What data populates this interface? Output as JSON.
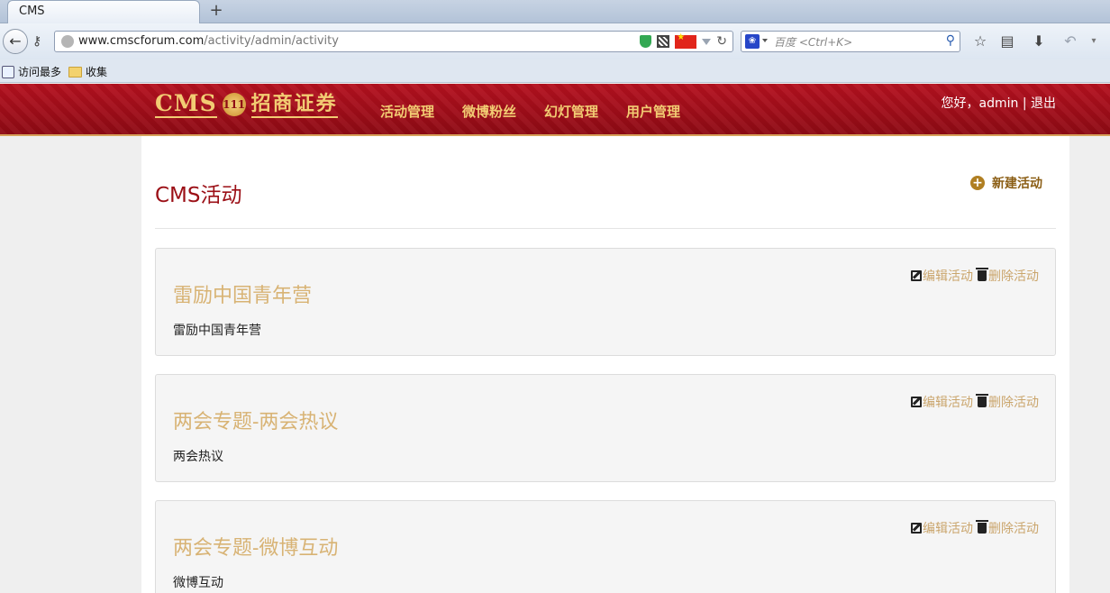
{
  "browser": {
    "tab_title": "CMS",
    "new_tab_symbol": "+",
    "url_domain": "www.cmscforum.com",
    "url_path": "/activity/admin/activity",
    "search_placeholder": "百度 <Ctrl+K>",
    "bookmarks": [
      {
        "label": "访问最多",
        "icon": "link-icon"
      },
      {
        "label": "收集",
        "icon": "folder-icon"
      }
    ]
  },
  "header": {
    "logo_text": "CMS",
    "logo_badge": "111",
    "logo_cn": "招商证券",
    "nav": [
      "活动管理",
      "微博粉丝",
      "幻灯管理",
      "用户管理"
    ],
    "greeting": "您好，admin | 退出"
  },
  "main": {
    "title": "CMS活动",
    "new_button": "新建活动",
    "activities": [
      {
        "title": "雷励中国青年营",
        "description": "雷励中国青年营",
        "edit": "编辑活动",
        "delete": "删除活动"
      },
      {
        "title": "两会专题-两会热议",
        "description": "两会热议",
        "edit": "编辑活动",
        "delete": "删除活动"
      },
      {
        "title": "两会专题-微博互动",
        "description": "微博互动",
        "edit": "编辑活动",
        "delete": "删除活动"
      }
    ]
  },
  "colors": {
    "header_red": "#a80f1b",
    "gold_text": "#f2cc73",
    "card_title": "#d8b374",
    "page_title": "#9b0f16"
  }
}
